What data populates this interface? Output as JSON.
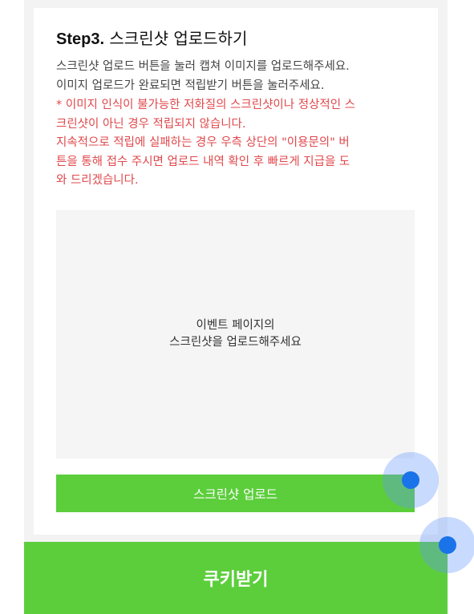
{
  "step": {
    "label": "Step3.",
    "title": "스크린샷 업로드하기"
  },
  "instructions": [
    "스크린샷 업로드 버튼을 눌러 캡쳐 이미지를 업로드해주세요.",
    "이미지 업로드가 완료되면 적립받기 버튼을 눌러주세요."
  ],
  "notice": [
    "* 이미지 인식이 불가능한 저화질의 스크린샷이나 정상적인 스",
    "크린샷이 아닌 경우 적립되지 않습니다.",
    "지속적으로 적립에 실패하는 경우 우측 상단의 \"이용문의\" 버",
    "튼을 통해 접수 주시면 업로드 내역 확인 후 빠르게 지급을 도",
    "와 드리겠습니다."
  ],
  "dropzone": {
    "line1": "이벤트 페이지의",
    "line2": "스크린샷을 업로드해주세요"
  },
  "buttons": {
    "upload": "스크린샷 업로드",
    "claim": "쿠키받기"
  },
  "colors": {
    "accent_green": "#5cce3c",
    "notice_red": "#e0484c",
    "touch_indicator": "#1a73e8"
  }
}
